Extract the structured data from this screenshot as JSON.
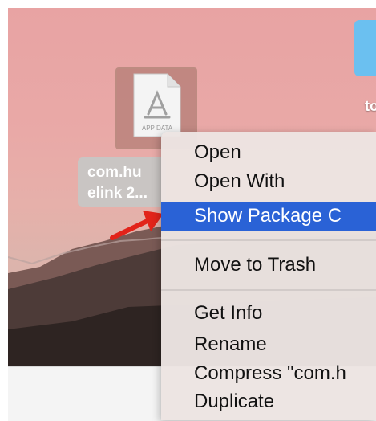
{
  "desktop": {
    "folder_label": "to",
    "file_label_line1": "com.hu",
    "file_label_line2": "elink 2...",
    "file_icon_text": "APP DATA",
    "icon": "app-data-document-icon"
  },
  "context_menu": {
    "items": [
      {
        "label": "Open"
      },
      {
        "label": "Open With"
      },
      {
        "label": "Show Package C"
      },
      {
        "label": "Move to Trash"
      },
      {
        "label": "Get Info"
      },
      {
        "label": "Rename"
      },
      {
        "label": "Compress \"com.h"
      },
      {
        "label": "Duplicate"
      }
    ],
    "highlighted_index": 2,
    "highlight_color": "#2a62d6"
  },
  "annotation": {
    "arrow_color": "#e2231a",
    "icon": "red-arrow-icon"
  }
}
